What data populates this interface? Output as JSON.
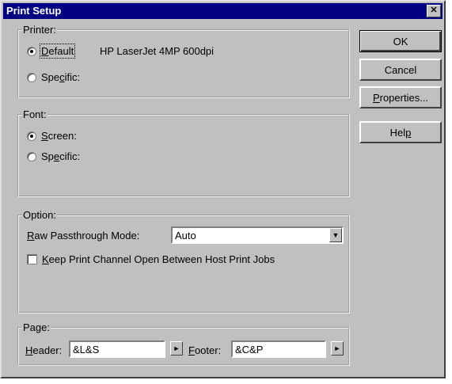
{
  "window": {
    "title": "Print Setup",
    "close_glyph": "✕"
  },
  "printer": {
    "legend": "Printer:",
    "default_label": "Default",
    "default_accel": "D",
    "default_rest": "efault",
    "printer_name": "HP LaserJet 4MP 600dpi",
    "specific_label_pre": "Spe",
    "specific_label_accel": "c",
    "specific_label_post": "ific:",
    "selected": "default"
  },
  "font": {
    "legend": "Font:",
    "screen_accel": "S",
    "screen_rest": "creen:",
    "specific_pre": "Sp",
    "specific_accel": "e",
    "specific_post": "cific:",
    "selected": "screen"
  },
  "option": {
    "legend": "Option:",
    "raw_accel": "R",
    "raw_rest": "aw Passthrough Mode:",
    "raw_value": "Auto",
    "keep_accel": "K",
    "keep_rest": "eep Print Channel Open Between Host Print Jobs",
    "keep_checked": false
  },
  "page": {
    "legend": "Page:",
    "header_accel": "H",
    "header_rest": "eader:",
    "header_value": "&L&S",
    "footer_accel": "F",
    "footer_rest": "ooter:",
    "footer_value": "&C&P"
  },
  "buttons": {
    "ok": "OK",
    "cancel": "Cancel",
    "properties_accel": "P",
    "properties_rest": "roperties...",
    "help_pre": "Hel",
    "help_accel": "p"
  },
  "icons": {
    "dropdown": "down-triangle",
    "insert": "right-triangle"
  }
}
